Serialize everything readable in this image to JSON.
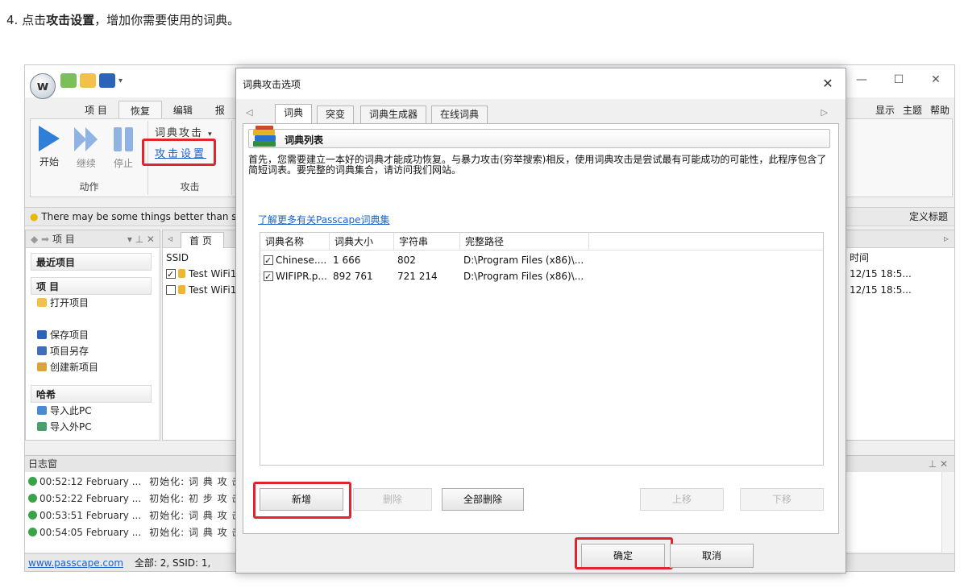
{
  "caption": {
    "prefix": "4. 点击",
    "bold": "攻击设置",
    "suffix": "，增加你需要使用的词典。"
  },
  "app": {
    "logo": "w",
    "window_controls": [
      "—",
      "☐",
      "✕"
    ],
    "menu_tabs": [
      "项 目",
      "恢复",
      "编辑",
      "报"
    ],
    "menu_right": [
      "显示",
      "主题",
      "帮助"
    ],
    "ribbon": {
      "start": "开始",
      "resume": "继续",
      "stop": "停止",
      "group_action": "动作",
      "dict_attack": "词典攻击",
      "attack_settings": "攻击设置",
      "group_attack": "攻击"
    },
    "infobar": {
      "text": "There may be some things better than s",
      "right": "定义标题"
    },
    "left_panel": {
      "head": "项 目",
      "recent": "最近项目",
      "project": "项 目",
      "open": "打开项目",
      "save": "保存项目",
      "save_as": "项目另存",
      "create": "创建新项目",
      "hash": "哈希",
      "import_this": "导入此PC",
      "import_other": "导入外PC"
    },
    "main_list": {
      "home_tab": "首页",
      "col": "SSID",
      "rows": [
        "Test WiFi1",
        "Test WiFi1"
      ]
    },
    "right_list": {
      "col": "时间",
      "rows": [
        "12/15 18:5...",
        "12/15 18:5..."
      ]
    },
    "log": {
      "title": "日志窗",
      "rows": [
        {
          "time": "00:52:12 February ...",
          "msg": "初始化: 词 典 攻 击"
        },
        {
          "time": "00:52:22 February ...",
          "msg": "初始化: 初 步 攻 击"
        },
        {
          "time": "00:53:51 February ...",
          "msg": "初始化: 词 典 攻 击"
        },
        {
          "time": "00:54:05 February ...",
          "msg": "初始化: 词 典 攻 击"
        }
      ]
    },
    "status": {
      "link": "www.passcape.com",
      "text": "全部: 2,   SSID: 1,"
    }
  },
  "dialog": {
    "title": "词典攻击选项",
    "close": "✕",
    "tabs": [
      "词典",
      "突变",
      "词典生成器",
      "在线词典"
    ],
    "header": "词典列表",
    "intro": "首先，您需要建立一本好的词典才能成功恢复。与暴力攻击(穷举搜索)相反，使用词典攻击是尝试最有可能成功的可能性，此程序包含了简短词表。要完整的词典集合，请访问我们网站。",
    "learn_more": "了解更多有关Passcape词典集",
    "columns": [
      "词典名称",
      "词典大小",
      "字符串",
      "完整路径"
    ],
    "rows": [
      {
        "name": "Chinese....",
        "size": "1 666",
        "strings": "802",
        "path": "D:\\Program Files (x86)\\...",
        "checked": true
      },
      {
        "name": "WIFIPR.p...",
        "size": "892 761",
        "strings": "721 214",
        "path": "D:\\Program Files (x86)\\...",
        "checked": true
      }
    ],
    "buttons": {
      "add": "新增",
      "delete": "删除",
      "delete_all": "全部删除",
      "up": "上移",
      "down": "下移",
      "ok": "确定",
      "cancel": "取消"
    }
  },
  "colors": {
    "highlight": "#e3232e",
    "link": "#1a62c9",
    "accent_blue": "#2f7fd9"
  }
}
